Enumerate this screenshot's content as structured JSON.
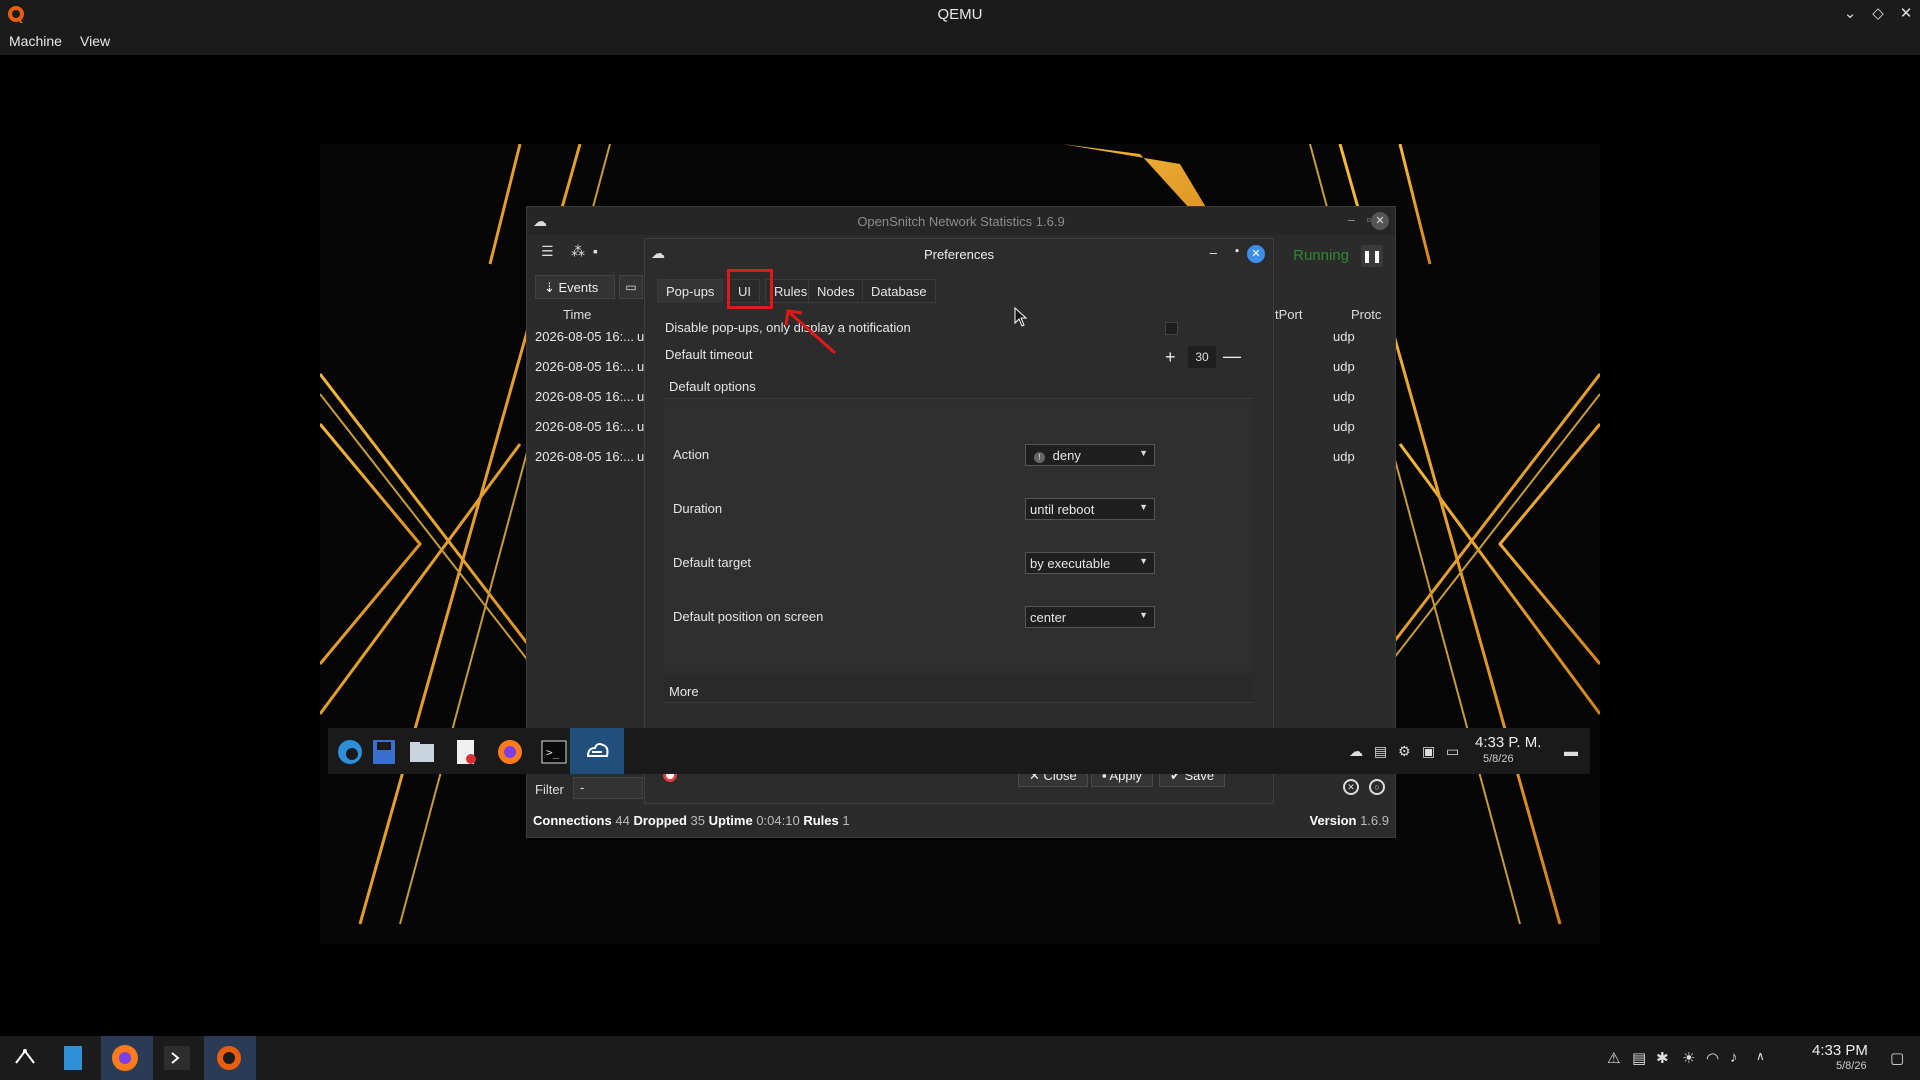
{
  "host": {
    "title": "QEMU",
    "menu": [
      "Machine",
      "View"
    ],
    "clock_time": "4:33 PM",
    "clock_date": "5/8/26"
  },
  "opensnitch": {
    "title": "OpenSnitch Network Statistics 1.6.9",
    "status": "Running",
    "events_tab": "Events",
    "columns": {
      "time": "Time",
      "dst_port": "tPort",
      "proto": "Protc"
    },
    "rows": [
      {
        "time": "2026-08-05 16:...",
        "u": "u",
        "proto": "udp"
      },
      {
        "time": "2026-08-05 16:...",
        "u": "u",
        "proto": "udp"
      },
      {
        "time": "2026-08-05 16:...",
        "u": "u",
        "proto": "udp"
      },
      {
        "time": "2026-08-05 16:...",
        "u": "u",
        "proto": "udp"
      },
      {
        "time": "2026-08-05 16:...",
        "u": "u",
        "proto": "udp"
      }
    ],
    "filter_label": "Filter",
    "filter_value": "-",
    "right_select": "0",
    "stats": {
      "connections_label": "Connections",
      "connections": "44",
      "dropped_label": "Dropped",
      "dropped": "35",
      "uptime_label": "Uptime",
      "uptime": "0:04:10",
      "rules_label": "Rules",
      "rules": "1"
    },
    "version_label": "Version",
    "version": "1.6.9"
  },
  "preferences": {
    "title": "Preferences",
    "tabs": [
      "Pop-ups",
      "UI",
      "Rules",
      "Nodes",
      "Database"
    ],
    "active_tab": "Pop-ups",
    "disable_popups_label": "Disable pop-ups, only display a notification",
    "default_timeout_label": "Default timeout",
    "default_timeout_value": "30",
    "default_options_label": "Default options",
    "options": [
      {
        "label": "Action",
        "value": "deny",
        "icon": "!"
      },
      {
        "label": "Duration",
        "value": "until reboot"
      },
      {
        "label": "Default target",
        "value": "by executable"
      },
      {
        "label": "Default position on screen",
        "value": "center"
      }
    ],
    "more_label": "More",
    "buttons": {
      "close": "Close",
      "apply": "Apply",
      "save": "Save"
    }
  },
  "guest_taskbar": {
    "time": "4:33 P. M.",
    "date": "5/8/26"
  }
}
